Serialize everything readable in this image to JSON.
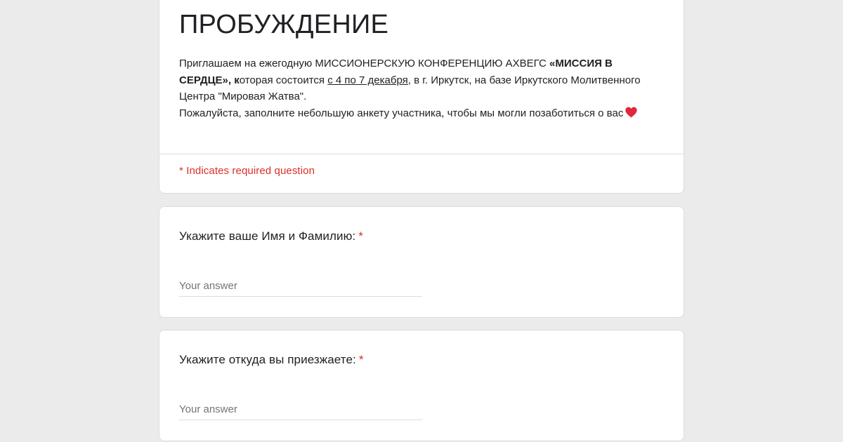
{
  "form": {
    "title": "ПРОБУЖДЕНИЕ",
    "description": {
      "line1_part1": "Приглашаем на ежегодную МИССИОНЕРСКУЮ КОНФЕРЕНЦИЮ АХВЕГС ",
      "line1_bold": "«МИССИЯ В СЕРДЦЕ», к",
      "line1_part2": "оторая состоится ",
      "dates": "с 4 по 7 декабря",
      "line1_part3": ", в г. Иркутск, на базе Иркутского Молитвенного Центра \"Мировая Жатва\".",
      "line2": "Пожалуйста, заполните небольшую анкету участника, чтобы мы могли позаботиться о вас"
    },
    "required_note": "* Indicates required question"
  },
  "questions": [
    {
      "title": "Укажите ваше Имя и Фамилию:",
      "required_mark": "*",
      "value": "",
      "placeholder": "Your answer"
    },
    {
      "title": "Укажите откуда вы приезжаете:",
      "required_mark": "*",
      "value": "",
      "placeholder": "Your answer"
    }
  ],
  "icons": {
    "heart": "heart-icon"
  },
  "colors": {
    "required": "#d93025",
    "heart": "#e0273b",
    "background": "#ebebeb"
  }
}
